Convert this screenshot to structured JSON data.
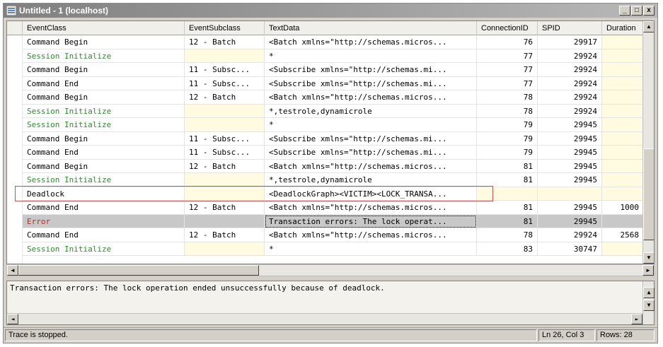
{
  "window": {
    "title": "Untitled - 1 (localhost)",
    "minimize": "_",
    "restore": "□",
    "close": "x"
  },
  "grid": {
    "columns": [
      "EventClass",
      "EventSubclass",
      "TextData",
      "ConnectionID",
      "SPID",
      "Duration"
    ],
    "rows": [
      {
        "event": "Command Begin",
        "sub": "12 - Batch",
        "text": "<Batch xmlns=\"http://schemas.micros...",
        "conn": "76",
        "spid": "29917",
        "dur": "",
        "color": "#000000"
      },
      {
        "event": "Session Initialize",
        "sub": "",
        "text": "*",
        "conn": "77",
        "spid": "29924",
        "dur": "",
        "color": "#2e8b2e"
      },
      {
        "event": "Command Begin",
        "sub": "11 - Subsc...",
        "text": "<Subscribe xmlns=\"http://schemas.mi...",
        "conn": "77",
        "spid": "29924",
        "dur": "",
        "color": "#000000"
      },
      {
        "event": "Command End",
        "sub": "11 - Subsc...",
        "text": "<Subscribe xmlns=\"http://schemas.mi...",
        "conn": "77",
        "spid": "29924",
        "dur": "",
        "color": "#000000"
      },
      {
        "event": "Command Begin",
        "sub": "12 - Batch",
        "text": "<Batch xmlns=\"http://schemas.micros...",
        "conn": "78",
        "spid": "29924",
        "dur": "",
        "color": "#000000"
      },
      {
        "event": "Session Initialize",
        "sub": "",
        "text": "*,testrole,dynamicrole",
        "conn": "78",
        "spid": "29924",
        "dur": "",
        "color": "#2e8b2e"
      },
      {
        "event": "Session Initialize",
        "sub": "",
        "text": "*",
        "conn": "79",
        "spid": "29945",
        "dur": "",
        "color": "#2e8b2e"
      },
      {
        "event": "Command Begin",
        "sub": "11 - Subsc...",
        "text": "<Subscribe xmlns=\"http://schemas.mi...",
        "conn": "79",
        "spid": "29945",
        "dur": "",
        "color": "#000000"
      },
      {
        "event": "Command End",
        "sub": "11 - Subsc...",
        "text": "<Subscribe xmlns=\"http://schemas.mi...",
        "conn": "79",
        "spid": "29945",
        "dur": "",
        "color": "#000000"
      },
      {
        "event": "Command Begin",
        "sub": "12 - Batch",
        "text": "<Batch xmlns=\"http://schemas.micros...",
        "conn": "81",
        "spid": "29945",
        "dur": "",
        "color": "#000000"
      },
      {
        "event": "Session Initialize",
        "sub": "",
        "text": "*,testrole,dynamicrole",
        "conn": "81",
        "spid": "29945",
        "dur": "",
        "color": "#2e8b2e"
      },
      {
        "event": "Deadlock",
        "sub": "",
        "text": "<DeadlockGraph><VICTIM><LOCK_TRANSA...",
        "conn": "",
        "spid": "",
        "dur": "",
        "color": "#000000"
      },
      {
        "event": "Command End",
        "sub": "12 - Batch",
        "text": "<Batch xmlns=\"http://schemas.micros...",
        "conn": "81",
        "spid": "29945",
        "dur": "1000",
        "color": "#000000"
      },
      {
        "event": "Error",
        "sub": "",
        "text": "Transaction errors: The lock operat...",
        "conn": "81",
        "spid": "29945",
        "dur": "",
        "color": "#d02020",
        "selected": true
      },
      {
        "event": "Command End",
        "sub": "12 - Batch",
        "text": "<Batch xmlns=\"http://schemas.micros...",
        "conn": "78",
        "spid": "29924",
        "dur": "2568",
        "color": "#000000"
      },
      {
        "event": "Session Initialize",
        "sub": "",
        "text": "*",
        "conn": "83",
        "spid": "30747",
        "dur": "",
        "color": "#2e8b2e"
      }
    ]
  },
  "detail": {
    "text": "Transaction errors: The lock operation ended unsuccessfully because of deadlock."
  },
  "status": {
    "message": "Trace is stopped.",
    "position": "Ln 26, Col 3",
    "rows": "Rows: 28"
  },
  "scroll": {
    "up": "▲",
    "down": "▼",
    "left": "◄",
    "right": "►"
  }
}
